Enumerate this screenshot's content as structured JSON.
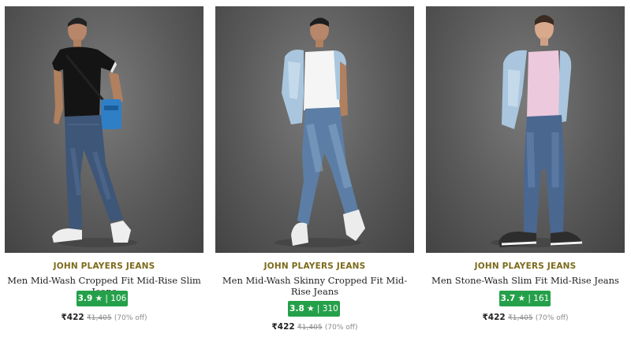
{
  "products": [
    {
      "brand": "JOHN PLAYERS JEANS",
      "name": "Men Mid-Wash Cropped Fit Mid-Rise Slim Jeans",
      "rating": "3.9",
      "star": "★",
      "separator": "|",
      "reviews": "106",
      "price": "₹422",
      "mrp": "₹1,405",
      "discount": "(70% off)"
    },
    {
      "brand": "JOHN PLAYERS JEANS",
      "name": "Men Mid-Wash Skinny Cropped Fit Mid-Rise Jeans",
      "rating": "3.8",
      "star": "★",
      "separator": "|",
      "reviews": "310",
      "price": "₹422",
      "mrp": "₹1,405",
      "discount": "(70% off)"
    },
    {
      "brand": "JOHN PLAYERS JEANS",
      "name": "Men Stone-Wash Slim Fit Mid-Rise Jeans",
      "rating": "3.7",
      "star": "★",
      "separator": "|",
      "reviews": "161",
      "price": "₹422",
      "mrp": "₹1,405",
      "discount": "(70% off)"
    }
  ],
  "colors": {
    "brand_text": "#7c6a1a",
    "rating_badge": "#25a04a",
    "photo_background": "#5a5a5a"
  }
}
